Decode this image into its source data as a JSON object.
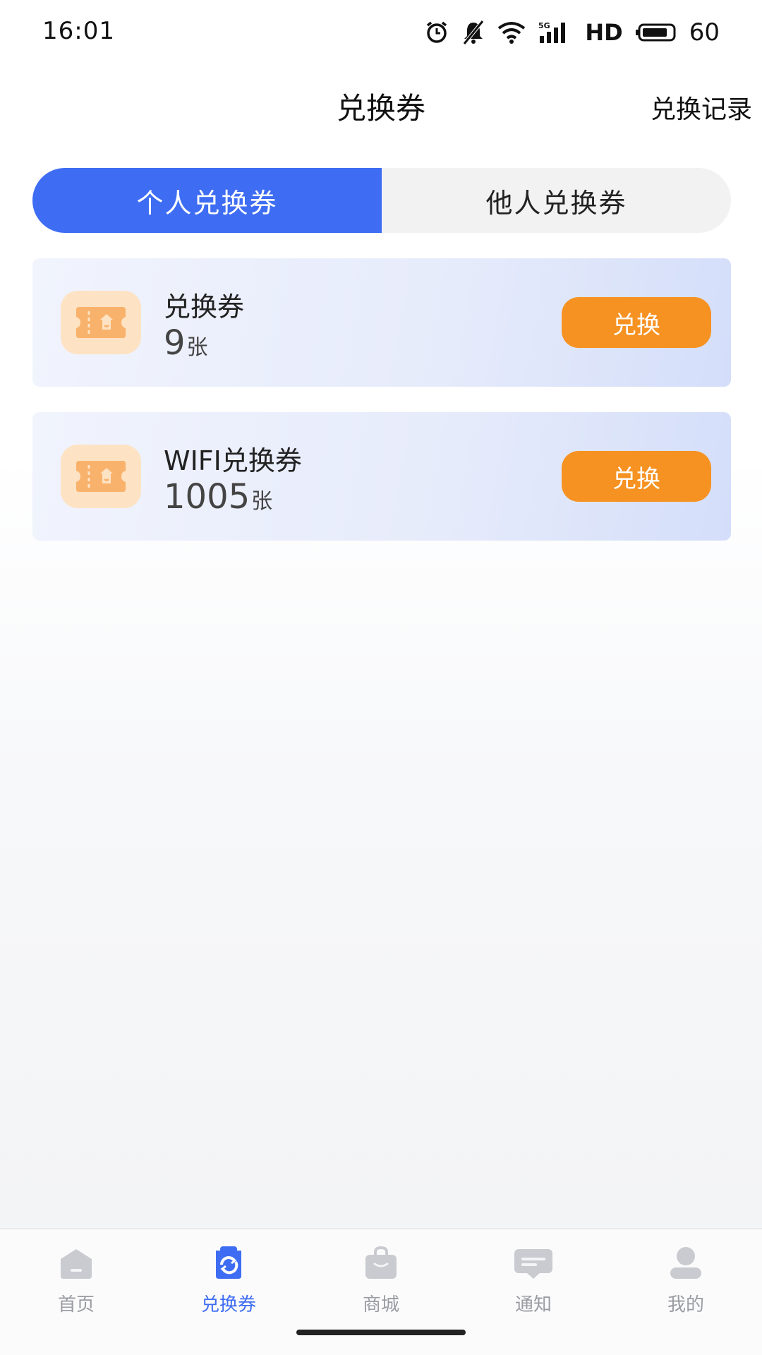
{
  "status_bar": {
    "time": "16:01",
    "network_label": "HD",
    "battery_level": "60",
    "icons": [
      "alarm-icon",
      "mute-icon",
      "wifi-icon",
      "signal-5g-icon",
      "battery-icon"
    ]
  },
  "header": {
    "title": "兑换券",
    "history_label": "兑换记录"
  },
  "tabs": [
    {
      "label": "个人兑换券",
      "active": true
    },
    {
      "label": "他人兑换券",
      "active": false
    }
  ],
  "vouchers": [
    {
      "name": "兑换券",
      "count": "9",
      "unit": "张",
      "button_label": "兑换",
      "icon": "ticket-icon"
    },
    {
      "name": "WIFI兑换券",
      "count": "1005",
      "unit": "张",
      "button_label": "兑换",
      "icon": "ticket-icon"
    }
  ],
  "bottom_nav": [
    {
      "label": "首页",
      "icon": "home-icon",
      "active": false
    },
    {
      "label": "兑换券",
      "icon": "voucher-icon",
      "active": true
    },
    {
      "label": "商城",
      "icon": "shop-bag-icon",
      "active": false
    },
    {
      "label": "通知",
      "icon": "message-icon",
      "active": false
    },
    {
      "label": "我的",
      "icon": "profile-icon",
      "active": false
    }
  ],
  "colors": {
    "accent": "#3e6df3",
    "button": "#f69222",
    "icon_bg": "#fde2c4",
    "icon_fg": "#f9b26b"
  }
}
